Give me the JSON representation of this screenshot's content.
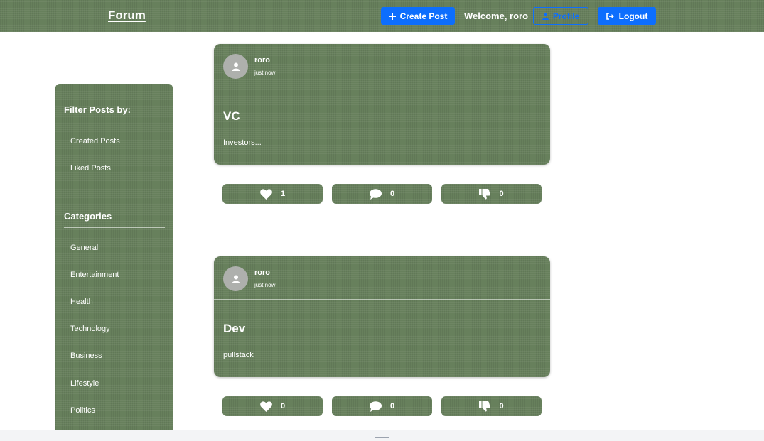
{
  "header": {
    "brand": "Forum",
    "create_post_label": "Create Post",
    "welcome": "Welcome, roro",
    "profile_label": "Profile",
    "logout_label": "Logout"
  },
  "sidebar": {
    "filter_heading": "Filter Posts by:",
    "filters": [
      "Created Posts",
      "Liked Posts"
    ],
    "categories_heading": "Categories",
    "categories": [
      "General",
      "Entertainment",
      "Health",
      "Technology",
      "Business",
      "Lifestyle",
      "Politics"
    ]
  },
  "posts": [
    {
      "author": "roro",
      "time": "just now",
      "title": "VC",
      "body": "Investors...",
      "likes": "1",
      "comments": "0",
      "dislikes": "0"
    },
    {
      "author": "roro",
      "time": "just now",
      "title": "Dev",
      "body": "pullstack",
      "likes": "0",
      "comments": "0",
      "dislikes": "0"
    }
  ],
  "colors": {
    "panel": "#67805c",
    "primary": "#0d6efd"
  },
  "icons": [
    "plus-icon",
    "user-icon",
    "logout-icon",
    "heart-icon",
    "comment-icon",
    "thumbs-down-icon",
    "avatar-icon"
  ]
}
